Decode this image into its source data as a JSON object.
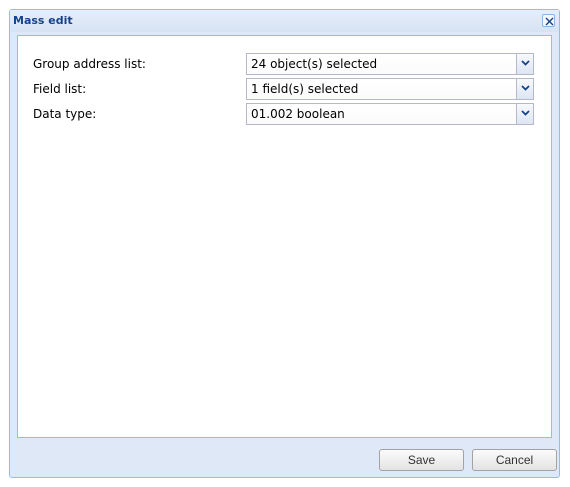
{
  "window": {
    "title": "Mass edit"
  },
  "form": {
    "rows": [
      {
        "label": "Group address list:",
        "value": "24 object(s) selected"
      },
      {
        "label": "Field list:",
        "value": "1 field(s) selected"
      },
      {
        "label": "Data type:",
        "value": "01.002 boolean"
      }
    ]
  },
  "footer": {
    "save_label": "Save",
    "cancel_label": "Cancel"
  },
  "icons": {
    "close": "close-icon",
    "dropdown": "chevron-down-icon"
  },
  "colors": {
    "title_text": "#15428b",
    "panel_border": "#99bbe8",
    "panel_background": "#dfe8f6"
  }
}
